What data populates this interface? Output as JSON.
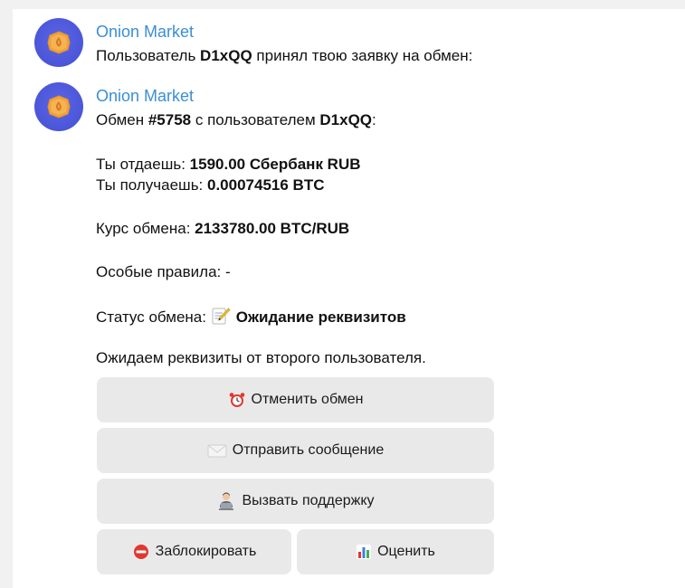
{
  "messages": [
    {
      "sender": "Onion Market",
      "line1": {
        "pre": "Пользователь ",
        "bold": "D1xQQ",
        "post": " принял твою заявку на обмен:"
      }
    },
    {
      "sender": "Onion Market",
      "header": {
        "pre": "Обмен ",
        "bold1": "#5758",
        "mid": " с пользователем ",
        "bold2": "D1xQQ",
        "post": ":"
      },
      "give": {
        "label": "Ты отдаешь: ",
        "value": "1590.00 Сбербанк RUB"
      },
      "get": {
        "label": "Ты получаешь: ",
        "value": "0.00074516 BTC"
      },
      "rate": {
        "label": "Курс обмена: ",
        "value": "2133780.00 BTC/RUB"
      },
      "rules": {
        "label": "Особые правила: ",
        "value": "-"
      },
      "status": {
        "label": "Статус обмена: ",
        "value": "Ожидание реквизитов"
      },
      "waiting": "Ожидаем реквизиты от второго пользователя."
    }
  ],
  "keyboard": {
    "cancel": "Отменить обмен",
    "message": "Отправить сообщение",
    "support": "Вызвать поддержку",
    "block": "Заблокировать",
    "rate": "Оценить"
  },
  "icons": {
    "avatar": "onion-coin-icon",
    "status": "memo-icon",
    "cancel": "alarm-clock-icon",
    "message": "envelope-icon",
    "support": "person-at-computer-icon",
    "block": "no-entry-icon",
    "rate": "bar-chart-icon"
  },
  "colors": {
    "sender": "#3a8fd6",
    "avatar_bg": "#4b55d8",
    "coin": "#f0a13a",
    "button_bg": "#e9e9ea",
    "page_bg": "#f1f1f2"
  }
}
